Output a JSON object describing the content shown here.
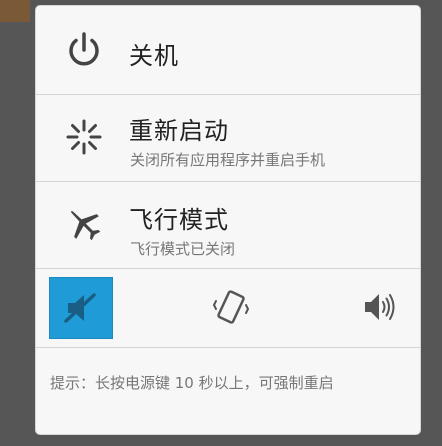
{
  "power_menu": {
    "items": [
      {
        "label": "关机",
        "icon": "power-icon"
      },
      {
        "label": "重新启动",
        "sublabel": "关闭所有应用程序并重启手机",
        "icon": "restart-icon"
      },
      {
        "label": "飞行模式",
        "sublabel": "飞行模式已关闭",
        "icon": "airplane-icon"
      }
    ],
    "sound_modes": [
      {
        "name": "silent",
        "icon": "speaker-muted-icon",
        "selected": true
      },
      {
        "name": "vibrate",
        "icon": "vibrate-phone-icon",
        "selected": false
      },
      {
        "name": "normal",
        "icon": "speaker-icon",
        "selected": false
      }
    ],
    "hint": "提示：长按电源键 10 秒以上，可强制重启"
  },
  "colors": {
    "accent": "#1f9cd7",
    "icon": "#444444",
    "background": "#565656",
    "dialog": "#f7f7f7"
  }
}
